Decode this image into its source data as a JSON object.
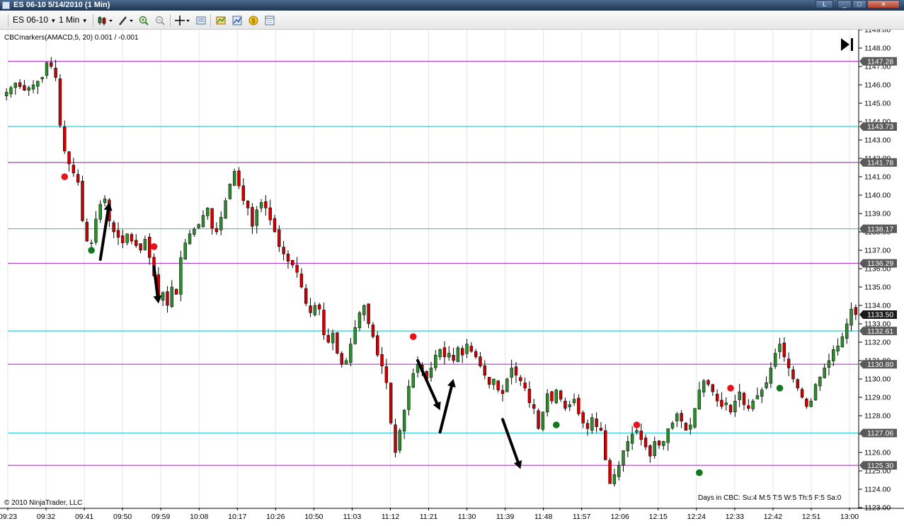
{
  "window": {
    "title": "ES 06-10  5/14/2010 (1 Min)",
    "buttons": [
      "L",
      "_",
      "□",
      "✕"
    ]
  },
  "toolbar": {
    "instrument": "ES 06-10",
    "interval": "1 Min",
    "icons": [
      "bar-type-icon",
      "drawing-tool-icon",
      "zoom-in-icon",
      "zoom-out-icon",
      "crosshair-icon",
      "data-box-icon",
      "indicators-icon",
      "strategies-icon",
      "properties-icon",
      "chart-trader-icon"
    ]
  },
  "indicator_label": "CBCmarkers(AMACD,5, 20) 0.001 / -0.001",
  "copyright": "© 2010 NinjaTrader, LLC",
  "status_text": "Days in CBC: Su:4 M:5 T:5 W:5 Th:5 F:5 Sa:0",
  "colors": {
    "up_candle": "#2e8b2e",
    "down_candle": "#cc0000",
    "magenta_line": "#b03cc8",
    "cyan_line": "#33cccc",
    "red_marker": "#e8141b",
    "green_marker": "#0f7a1c"
  },
  "chart_data": {
    "type": "candlestick",
    "instrument": "ES 06-10",
    "ylim": [
      1123.0,
      1149.0
    ],
    "y_ticks": [
      1123,
      1124,
      1125,
      1126,
      1127,
      1128,
      1129,
      1130,
      1131,
      1132,
      1133,
      1134,
      1135,
      1136,
      1137,
      1138,
      1139,
      1140,
      1141,
      1142,
      1143,
      1144,
      1145,
      1146,
      1147,
      1148,
      1149
    ],
    "y_tick_labels": [
      "1123.00",
      "1124.00",
      "1125.00",
      "1126.00",
      "1127.00",
      "1128.00",
      "1129.00",
      "1130.00",
      "1131.00",
      "1132.00",
      "1133.00",
      "1134.00",
      "1135.00",
      "1136.00",
      "1137.00",
      "1138.00",
      "1139.00",
      "1140.00",
      "1141.00",
      "1142.00",
      "1143.00",
      "1144.00",
      "1145.00",
      "1146.00",
      "1147.00",
      "1148.00",
      "1149.00"
    ],
    "x_labels": [
      "09:23",
      "09:32",
      "09:41",
      "09:50",
      "09:59",
      "10:08",
      "10:17",
      "10:26",
      "10:50",
      "11:03",
      "11:12",
      "11:21",
      "11:30",
      "11:39",
      "11:48",
      "11:57",
      "12:06",
      "12:15",
      "12:24",
      "12:33",
      "12:42",
      "12:51",
      "13:00"
    ],
    "horizontal_lines": [
      {
        "price": 1147.28,
        "label": "1147.28",
        "color": "magenta"
      },
      {
        "price": 1143.73,
        "label": "1143.73",
        "color": "cyan"
      },
      {
        "price": 1141.78,
        "label": "1141.78",
        "color": "magenta"
      },
      {
        "price": 1138.17,
        "label": "1138.17",
        "color": "cyan"
      },
      {
        "price": 1136.29,
        "label": "1136.29",
        "color": "magenta"
      },
      {
        "price": 1132.61,
        "label": "1132.61",
        "color": "cyan"
      },
      {
        "price": 1130.8,
        "label": "1130.80",
        "color": "magenta"
      },
      {
        "price": 1127.06,
        "label": "1127.06",
        "color": "cyan"
      },
      {
        "price": 1125.3,
        "label": "1125.30",
        "color": "magenta"
      }
    ],
    "current_price": {
      "price": 1133.5,
      "label": "1133.50"
    },
    "close_path": [
      [
        0,
        1145.6
      ],
      [
        2,
        1146.1
      ],
      [
        4,
        1145.7
      ],
      [
        6,
        1146.0
      ],
      [
        8,
        1146.4
      ],
      [
        9,
        1147.2
      ],
      [
        10,
        1147.0
      ],
      [
        11,
        1146.4
      ],
      [
        12,
        1143.8
      ],
      [
        13,
        1142.4
      ],
      [
        14,
        1141.7
      ],
      [
        15,
        1141.2
      ],
      [
        16,
        1140.7
      ],
      [
        17,
        1138.6
      ],
      [
        18,
        1137.5
      ],
      [
        19,
        1137.4
      ],
      [
        20,
        1138.7
      ],
      [
        21,
        1139.5
      ],
      [
        22,
        1139.8
      ],
      [
        23,
        1138.6
      ],
      [
        24,
        1138.0
      ],
      [
        26,
        1137.4
      ],
      [
        27,
        1137.9
      ],
      [
        28,
        1137.5
      ],
      [
        30,
        1137.0
      ],
      [
        31,
        1137.6
      ],
      [
        33,
        1135.6
      ],
      [
        34,
        1134.4
      ],
      [
        35,
        1134.7
      ],
      [
        36,
        1134.0
      ],
      [
        37,
        1135.0
      ],
      [
        38,
        1134.6
      ],
      [
        39,
        1136.6
      ],
      [
        40,
        1137.4
      ],
      [
        41,
        1137.9
      ],
      [
        43,
        1138.4
      ],
      [
        44,
        1138.9
      ],
      [
        45,
        1139.3
      ],
      [
        46,
        1138.2
      ],
      [
        47,
        1138.0
      ],
      [
        48,
        1138.8
      ],
      [
        49,
        1139.7
      ],
      [
        50,
        1140.6
      ],
      [
        51,
        1141.3
      ],
      [
        52,
        1140.5
      ],
      [
        53,
        1139.7
      ],
      [
        54,
        1139.3
      ],
      [
        55,
        1138.3
      ],
      [
        56,
        1139.2
      ],
      [
        57,
        1139.6
      ],
      [
        58,
        1139.3
      ],
      [
        60,
        1138.0
      ],
      [
        61,
        1137.2
      ],
      [
        62,
        1136.8
      ],
      [
        63,
        1136.4
      ],
      [
        64,
        1136.2
      ],
      [
        65,
        1135.8
      ],
      [
        66,
        1135.0
      ],
      [
        67,
        1134.1
      ],
      [
        68,
        1133.6
      ],
      [
        69,
        1134.0
      ],
      [
        70,
        1133.8
      ],
      [
        71,
        1132.4
      ],
      [
        72,
        1132.0
      ],
      [
        73,
        1132.5
      ],
      [
        74,
        1131.4
      ],
      [
        75,
        1130.8
      ],
      [
        76,
        1131.0
      ],
      [
        77,
        1131.9
      ],
      [
        78,
        1132.8
      ],
      [
        79,
        1133.6
      ],
      [
        80,
        1134.0
      ],
      [
        81,
        1133.0
      ],
      [
        82,
        1132.3
      ],
      [
        83,
        1131.3
      ],
      [
        84,
        1130.7
      ],
      [
        85,
        1129.8
      ],
      [
        86,
        1127.6
      ],
      [
        87,
        1126.0
      ],
      [
        88,
        1127.2
      ],
      [
        89,
        1128.3
      ],
      [
        90,
        1129.6
      ],
      [
        91,
        1130.3
      ],
      [
        92,
        1130.8
      ],
      [
        93,
        1130.4
      ],
      [
        94,
        1130.0
      ],
      [
        95,
        1130.6
      ],
      [
        96,
        1131.3
      ],
      [
        97,
        1131.6
      ],
      [
        98,
        1131.2
      ],
      [
        99,
        1131.4
      ],
      [
        100,
        1131.0
      ],
      [
        101,
        1131.7
      ],
      [
        102,
        1131.3
      ],
      [
        103,
        1131.9
      ],
      [
        104,
        1131.5
      ],
      [
        105,
        1131.2
      ],
      [
        106,
        1130.7
      ],
      [
        107,
        1130.2
      ],
      [
        108,
        1129.7
      ],
      [
        109,
        1130.0
      ],
      [
        110,
        1129.4
      ],
      [
        111,
        1129.2
      ],
      [
        112,
        1130.0
      ],
      [
        113,
        1130.6
      ],
      [
        114,
        1130.2
      ],
      [
        115,
        1129.9
      ],
      [
        116,
        1129.5
      ],
      [
        117,
        1128.7
      ],
      [
        118,
        1128.4
      ],
      [
        119,
        1127.3
      ],
      [
        120,
        1128.2
      ],
      [
        121,
        1129.2
      ],
      [
        122,
        1128.8
      ],
      [
        123,
        1129.4
      ],
      [
        124,
        1128.9
      ],
      [
        125,
        1128.4
      ],
      [
        126,
        1128.6
      ],
      [
        127,
        1128.9
      ],
      [
        128,
        1128.1
      ],
      [
        129,
        1127.6
      ],
      [
        130,
        1127.3
      ],
      [
        131,
        1127.9
      ],
      [
        132,
        1127.4
      ],
      [
        133,
        1127.2
      ],
      [
        134,
        1125.6
      ],
      [
        135,
        1124.3
      ],
      [
        136,
        1124.8
      ],
      [
        137,
        1125.3
      ],
      [
        138,
        1126.1
      ],
      [
        139,
        1126.6
      ],
      [
        140,
        1127.0
      ],
      [
        141,
        1127.2
      ],
      [
        142,
        1126.7
      ],
      [
        143,
        1126.3
      ],
      [
        144,
        1125.8
      ],
      [
        145,
        1126.6
      ],
      [
        146,
        1126.4
      ],
      [
        147,
        1126.6
      ],
      [
        148,
        1127.3
      ],
      [
        149,
        1127.6
      ],
      [
        150,
        1128.1
      ],
      [
        151,
        1127.7
      ],
      [
        152,
        1127.2
      ],
      [
        153,
        1127.5
      ],
      [
        154,
        1128.4
      ],
      [
        155,
        1129.4
      ],
      [
        156,
        1129.9
      ],
      [
        157,
        1129.7
      ],
      [
        158,
        1129.3
      ],
      [
        159,
        1128.8
      ],
      [
        160,
        1128.5
      ],
      [
        161,
        1128.7
      ],
      [
        162,
        1128.2
      ],
      [
        163,
        1128.8
      ],
      [
        164,
        1129.3
      ],
      [
        165,
        1128.6
      ],
      [
        166,
        1128.4
      ],
      [
        167,
        1128.8
      ],
      [
        168,
        1129.1
      ],
      [
        169,
        1129.4
      ],
      [
        170,
        1129.8
      ],
      [
        171,
        1130.6
      ],
      [
        172,
        1131.4
      ],
      [
        173,
        1131.9
      ],
      [
        174,
        1131.2
      ],
      [
        175,
        1130.6
      ],
      [
        176,
        1130.0
      ],
      [
        177,
        1129.5
      ],
      [
        178,
        1129.0
      ],
      [
        179,
        1128.5
      ],
      [
        180,
        1128.8
      ],
      [
        181,
        1129.7
      ],
      [
        182,
        1130.1
      ],
      [
        183,
        1130.6
      ],
      [
        184,
        1131.0
      ],
      [
        185,
        1131.6
      ],
      [
        186,
        1131.8
      ],
      [
        187,
        1132.3
      ],
      [
        188,
        1133.0
      ],
      [
        189,
        1133.8
      ],
      [
        190,
        1133.5
      ]
    ],
    "markers": [
      {
        "bar": 19,
        "price": 1137.0,
        "color": "green"
      },
      {
        "bar": 13,
        "price": 1141.0,
        "color": "red"
      },
      {
        "bar": 33,
        "price": 1137.2,
        "color": "red"
      },
      {
        "bar": 91,
        "price": 1132.3,
        "color": "red"
      },
      {
        "bar": 123,
        "price": 1127.5,
        "color": "green"
      },
      {
        "bar": 141,
        "price": 1127.5,
        "color": "red"
      },
      {
        "bar": 155,
        "price": 1124.9,
        "color": "green"
      },
      {
        "bar": 162,
        "price": 1129.5,
        "color": "red"
      },
      {
        "bar": 173,
        "price": 1129.5,
        "color": "green"
      }
    ],
    "arrows": [
      {
        "from": [
          21,
          1136.5
        ],
        "to": [
          23,
          1139.6
        ]
      },
      {
        "from": [
          33,
          1136.1
        ],
        "to": [
          34,
          1134.1
        ]
      },
      {
        "from": [
          92,
          1131.0
        ],
        "to": [
          97,
          1128.3
        ]
      },
      {
        "from": [
          97,
          1127.1
        ],
        "to": [
          100,
          1130.0
        ]
      },
      {
        "from": [
          111,
          1127.8
        ],
        "to": [
          115,
          1125.1
        ]
      }
    ]
  }
}
